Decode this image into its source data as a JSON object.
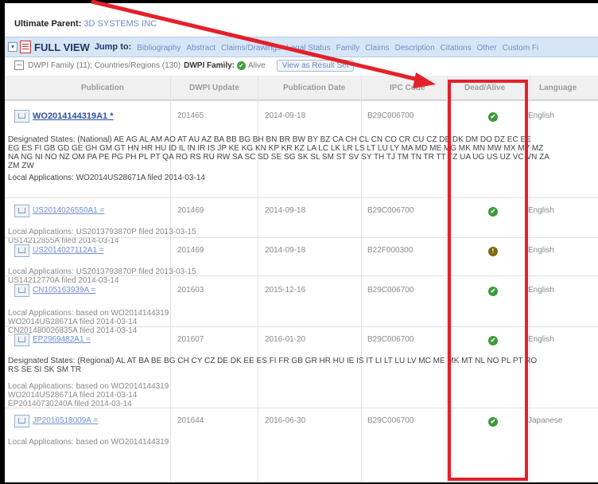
{
  "header": {
    "ultimate_parent_label": "Ultimate Parent:",
    "ultimate_parent_value": "3D SYSTEMS INC"
  },
  "tabs_bar": {
    "view_title": "FULL VIEW",
    "jump_to": "Jump to:",
    "links": [
      "Bibliography",
      "Abstract",
      "Claims/Drawings",
      "Legal Status",
      "Family",
      "Claims",
      "Description",
      "Citations",
      "Other",
      "Custom Fi"
    ]
  },
  "family_bar": {
    "family_text": "DWPI Family (11); Countries/Regions (130)",
    "dwpi_family_label": "DWPI Family:",
    "alive_label": "Alive",
    "view_button": "View as Result Set"
  },
  "columns": [
    "Publication",
    "DWPI Update",
    "Publication Date",
    "IPC Code",
    "Dead/Alive",
    "Language"
  ],
  "rows": [
    {
      "publication": "WO2014144319A1 *",
      "dwpi_update": "201465",
      "pub_date": "2014-09-18",
      "ipc": "B29C006700",
      "status": "alive",
      "language": "English",
      "main": true,
      "notes": [
        {
          "text": "Designated States: (National) AE AG AL AM AO AT AU AZ BA BB BG BH BN BR BW BY BZ CA CH CL CN CO CR CU CZ DE DK DM DO DZ EC EE\nEG ES FI GB GD GE GH GM GT HN HR HU ID IL IN IR IS JP KE KG KN KP KR KZ LA LC LK LR LS LT LU LY MA MD ME MG MK MN MW MX MY MZ\nNA NG NI NO NZ OM PA PE PG PH PL PT QA RO RS RU RW SA SC SD SE SG SK SL SM ST SV SY TH TJ TM TN TR TT TZ UA UG US UZ VC VN ZA\nZM ZW",
          "dark": true
        },
        {
          "text": "Local Applications: WO2014US28671A filed 2014-03-14",
          "dark": true
        }
      ]
    },
    {
      "publication": "US2014026550A1 =",
      "dwpi_update": "201469",
      "pub_date": "2014-09-18",
      "ipc": "B29C006700",
      "status": "alive",
      "language": "English",
      "notes": [
        {
          "text": "Local Applications: US2013793870P filed 2013-03-15\nUS14212855A filed 2014-03-14",
          "dark": false
        }
      ]
    },
    {
      "publication": "US2014027112A1 =",
      "dwpi_update": "201469",
      "pub_date": "2014-09-18",
      "ipc": "B22F000300",
      "status": "warn",
      "language": "English",
      "notes": [
        {
          "text": "Local Applications: US2013793870P filed 2013-03-15\nUS14212770A filed 2014-03-14",
          "dark": false
        }
      ]
    },
    {
      "publication": "CN105163939A =",
      "dwpi_update": "201603",
      "pub_date": "2015-12-16",
      "ipc": "B29C006700",
      "status": "alive",
      "language": "English",
      "notes": [
        {
          "text": "Local Applications: based on WO2014144319\nWO2014US28671A filed 2014-03-14\nCN201480026835A filed 2014-03-14",
          "dark": false
        }
      ]
    },
    {
      "publication": "EP2969482A1 =",
      "dwpi_update": "201607",
      "pub_date": "2016-01-20",
      "ipc": "B29C006700",
      "status": "alive",
      "language": "English",
      "notes": [
        {
          "text": "Designated States: (Regional) AL AT BA BE BG CH CY CZ DE DK EE ES FI FR GB GR HR HU IE IS IT LI LT LU LV MC ME MK MT NL NO PL PT RO\nRS SE SI SK SM TR",
          "dark": true
        },
        {
          "text": "Local Applications: based on WO2014144319\nWO2014US28671A filed 2014-03-14\nEP20140730240A filed 2014-03-14",
          "dark": false
        }
      ]
    },
    {
      "publication": "JP2016518009A =",
      "dwpi_update": "201644",
      "pub_date": "2016-06-30",
      "ipc": "B29C006700",
      "status": "alive",
      "language": "Japanese",
      "notes": [
        {
          "text": "Local Applications: based on WO2014144319",
          "dark": false
        }
      ]
    }
  ]
}
